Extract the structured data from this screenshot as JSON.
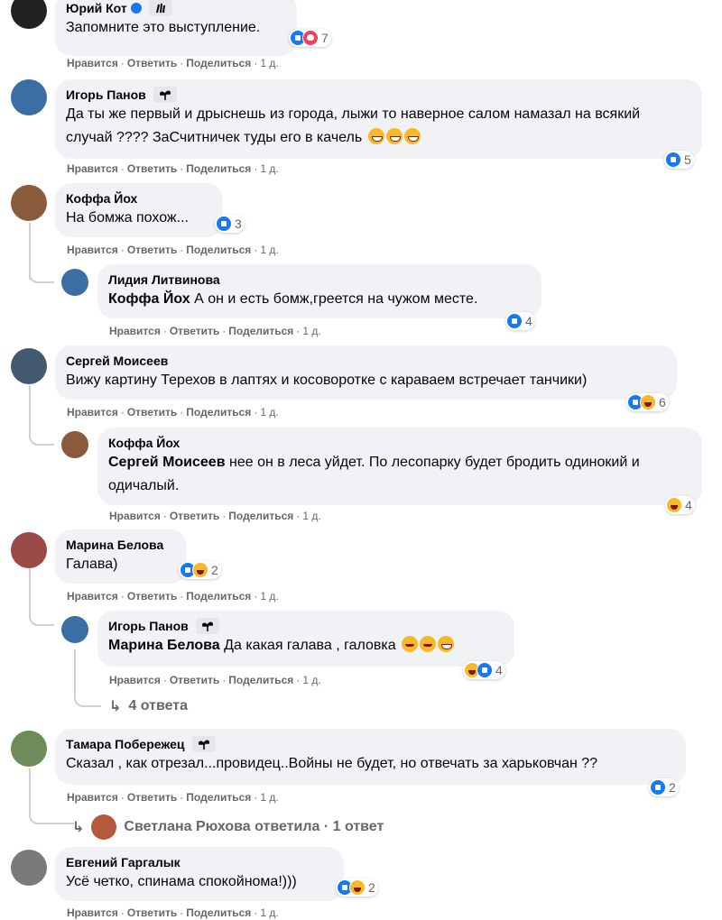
{
  "comments": [
    {
      "name": "Юрий Кот",
      "text": "Запомните это выступление.",
      "reactions": "7",
      "actions": {
        "like": "Нравится",
        "reply": "Ответить",
        "share": "Поделиться",
        "time": "1 д."
      }
    },
    {
      "name": "Игорь Панов",
      "text": "Да ты же первый и дрыснешь из города, лыжи то наверное салом намазал на всякий случай ???? ЗаСчитничек туды его в качель",
      "reactions": "5",
      "actions": {
        "like": "Нравится",
        "reply": "Ответить",
        "share": "Поделиться",
        "time": "1 д."
      }
    },
    {
      "name": "Коффа Йох",
      "text": "На бомжа похож...",
      "reactions": "3",
      "actions": {
        "like": "Нравится",
        "reply": "Ответить",
        "share": "Поделиться",
        "time": "1 д."
      }
    },
    {
      "name": "Лидия Литвинова",
      "mention": "Коффа Йох",
      "text": "А он и есть бомж,греется на чужом месте.",
      "reactions": "4",
      "actions": {
        "like": "Нравится",
        "reply": "Ответить",
        "share": "Поделиться",
        "time": "1 д."
      }
    },
    {
      "name": "Сергей Моисеев",
      "text": "Вижу картину Терехов в лаптях и косоворотке с караваем встречает танчики)",
      "reactions": "6",
      "actions": {
        "like": "Нравится",
        "reply": "Ответить",
        "share": "Поделиться",
        "time": "1 д."
      }
    },
    {
      "name": "Коффа Йох",
      "mention": "Сергей Моисеев",
      "text": "нее он в леса уйдет. По лесопарку будет бродить одинокий и одичалый.",
      "reactions": "4",
      "actions": {
        "like": "Нравится",
        "reply": "Ответить",
        "share": "Поделиться",
        "time": "1 д."
      }
    },
    {
      "name": "Марина Белова",
      "text": "Галава)",
      "reactions": "2",
      "actions": {
        "like": "Нравится",
        "reply": "Ответить",
        "share": "Поделиться",
        "time": "1 д."
      }
    },
    {
      "name": "Игорь Панов",
      "mention": "Марина Белова",
      "text": "Да какая галава , галовка",
      "reactions": "4",
      "actions": {
        "like": "Нравится",
        "reply": "Ответить",
        "share": "Поделиться",
        "time": "1 д."
      }
    },
    {
      "name": "Тамара Побережец",
      "text": "Сказал , как отрезал...провидец..Войны не будет, но отвечать за харьковчан ??",
      "reactions": "2",
      "actions": {
        "like": "Нравится",
        "reply": "Ответить",
        "share": "Поделиться",
        "time": "1 д."
      }
    },
    {
      "name": "Евгений Гаргалык",
      "text": "Усё четко, спинама спокойнома!)))",
      "reactions": "2",
      "actions": {
        "like": "Нравится",
        "reply": "Ответить",
        "share": "Поделиться",
        "time": "1 д."
      }
    }
  ],
  "more_replies": "4 ответа",
  "replied_summary": "Светлана Рюхова ответила · 1 ответ",
  "colors": {
    "bubble": "#f0f2f5",
    "meta": "#65676b",
    "like": "#1877f2",
    "love": "#f33e58",
    "haha": "#f7b928"
  }
}
